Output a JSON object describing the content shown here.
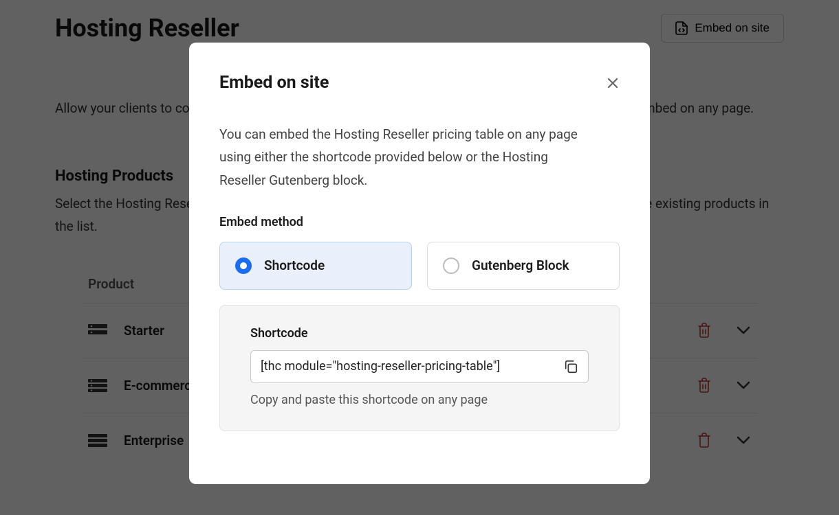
{
  "page": {
    "title": "Hosting Reseller",
    "embed_button": "Embed on site",
    "description": "Allow your clients to compare the pricing features of your Hosting Reseller pricing table that you can embed on any page.",
    "products_section": {
      "title": "Hosting Products",
      "description": "Select the Hosting Reseller products that you want to offer clients. You can drag and drop or update the existing products in the list.",
      "column_header": "Product",
      "items": [
        {
          "name": "Starter"
        },
        {
          "name": "E-commerce"
        },
        {
          "name": "Enterprise"
        }
      ]
    }
  },
  "modal": {
    "title": "Embed on site",
    "description": "You can embed the Hosting Reseller pricing table on any page using either the shortcode provided below or the Hosting Reseller Gutenberg block.",
    "method_label": "Embed method",
    "options": {
      "shortcode": "Shortcode",
      "gutenberg": "Gutenberg Block"
    },
    "shortcode": {
      "label": "Shortcode",
      "value": "[thc module=\"hosting-reseller-pricing-table\"]",
      "help": "Copy and paste this shortcode on any page"
    }
  }
}
